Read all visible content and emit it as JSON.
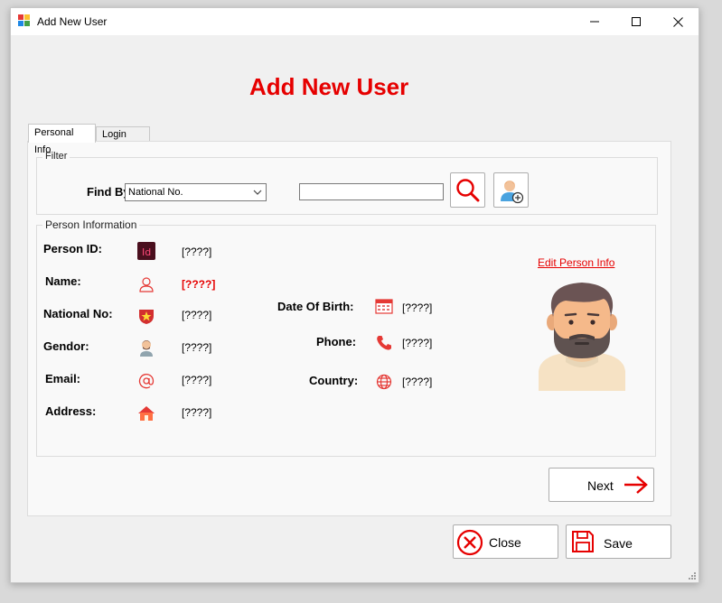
{
  "window": {
    "title": "Add New User"
  },
  "heading": "Add New User",
  "tabs": [
    {
      "label": "Personal Info",
      "active": true
    },
    {
      "label": "Login Info",
      "active": false
    }
  ],
  "filter": {
    "legend": "Filter",
    "find_by_label": "Find By:",
    "find_by_selected": "National No.",
    "search_value": ""
  },
  "person": {
    "legend": "Person Information",
    "fields": {
      "person_id": {
        "label": "Person ID:",
        "value": "[????]"
      },
      "name": {
        "label": "Name:",
        "value": "[????]"
      },
      "national_no": {
        "label": "National No:",
        "value": "[????]"
      },
      "gendor": {
        "label": "Gendor:",
        "value": "[????]"
      },
      "email": {
        "label": "Email:",
        "value": "[????]"
      },
      "address": {
        "label": "Address:",
        "value": "[????]"
      },
      "date_of_birth": {
        "label": "Date Of Birth:",
        "value": "[????]"
      },
      "phone": {
        "label": "Phone:",
        "value": "[????]"
      },
      "country": {
        "label": "Country:",
        "value": "[????]"
      }
    },
    "edit_link": "Edit Person Info"
  },
  "buttons": {
    "next": "Next",
    "close": "Close",
    "save": "Save"
  },
  "colors": {
    "accent": "#e60000",
    "background": "#f0f0f0"
  },
  "icons": [
    "app-icon",
    "minimize-icon",
    "maximize-icon",
    "close-window-icon",
    "search-icon",
    "add-person-icon",
    "id-icon",
    "user-icon",
    "national-badge-icon",
    "gender-icon",
    "email-icon",
    "home-icon",
    "calendar-icon",
    "phone-icon",
    "globe-icon",
    "avatar",
    "next-arrow-icon",
    "close-circle-icon",
    "save-floppy-icon"
  ]
}
